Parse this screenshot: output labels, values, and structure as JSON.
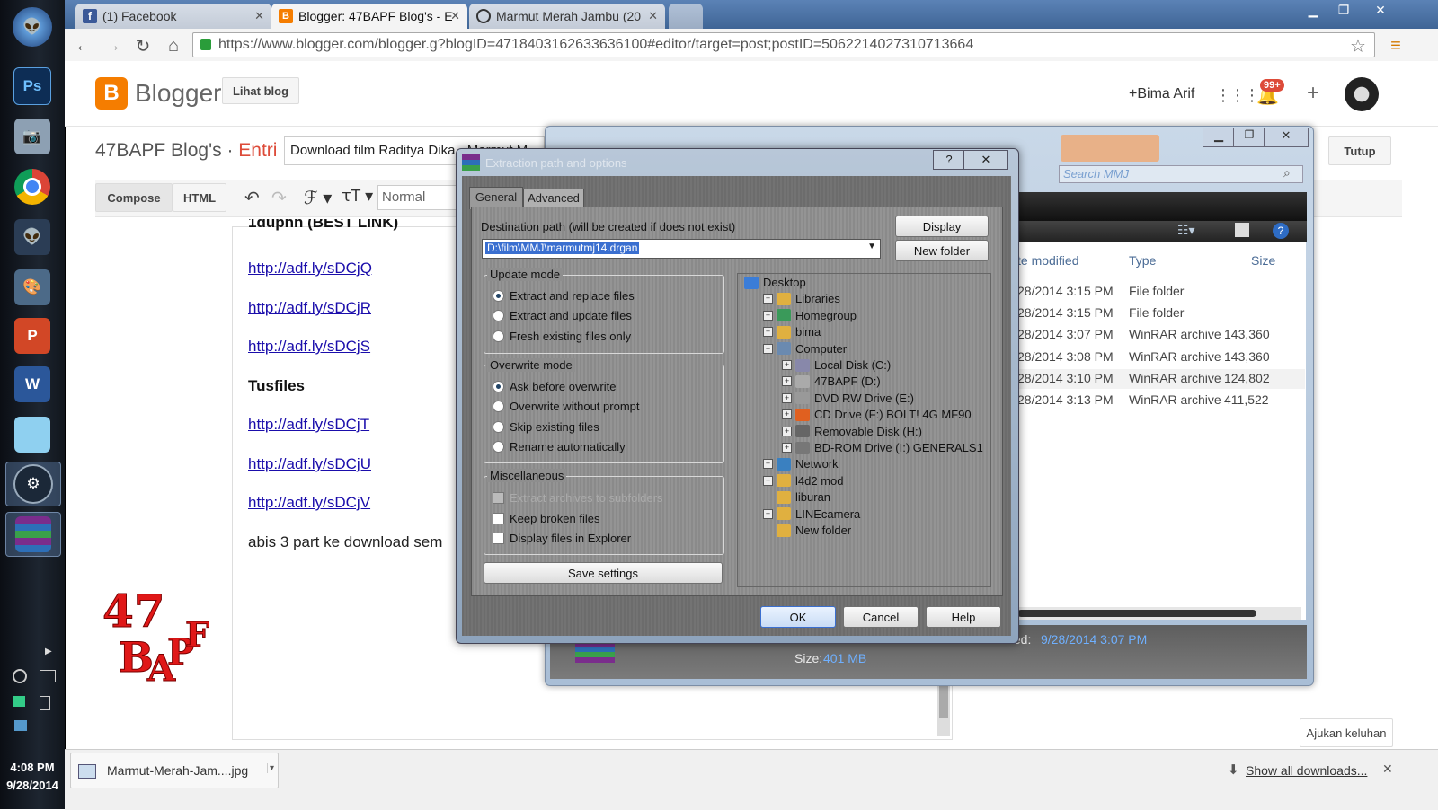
{
  "tabs": [
    {
      "label": "(1) Facebook"
    },
    {
      "label": "Blogger: 47BAPF Blog's - E"
    },
    {
      "label": "Marmut Merah Jambu (20"
    }
  ],
  "url": "https://www.blogger.com/blogger.g?blogID=4718403162633636100#editor/target=post;postID=5062214027310713664",
  "blogger": {
    "logo": "Blogger",
    "view_blog": "Lihat blog",
    "user": "+Bima Arif",
    "notif": "99+",
    "blog_name": "47BAPF Blog's",
    "separator": "·",
    "entry": "Entri",
    "post_title": "Download film Raditya Dika - Marmut M",
    "close": "Tutup",
    "compose": "Compose",
    "html": "HTML",
    "format": "Normal",
    "feedback": "Ajukan keluhan"
  },
  "editor": {
    "partial_heading": "1dupnn (BEST LINK)",
    "links1": [
      "http://adf.ly/sDCjQ",
      "http://adf.ly/sDCjR",
      "http://adf.ly/sDCjS"
    ],
    "tusfiles": "Tusfiles",
    "links2": [
      "http://adf.ly/sDCjT",
      "http://adf.ly/sDCjU",
      "http://adf.ly/sDCjV"
    ],
    "tail": "abis 3 part ke download sem"
  },
  "explorer": {
    "search": "Search MMJ",
    "cols": [
      "te modified",
      "Type",
      "Size"
    ],
    "rows": [
      {
        "date": "28/2014 3:15 PM",
        "type": "File folder",
        "size": ""
      },
      {
        "date": "28/2014 3:15 PM",
        "type": "File folder",
        "size": ""
      },
      {
        "date": "28/2014 3:07 PM",
        "type": "WinRAR archive",
        "size": "143,360"
      },
      {
        "date": "28/2014 3:08 PM",
        "type": "WinRAR archive",
        "size": "143,360"
      },
      {
        "date": "28/2014 3:10 PM",
        "type": "WinRAR archive",
        "size": "124,802"
      },
      {
        "date": "28/2014 3:13 PM",
        "type": "WinRAR archive",
        "size": "411,522"
      }
    ],
    "modified_label": "ted:",
    "modified_value": "9/28/2014 3:07 PM",
    "size_label": "Size:",
    "size_value": "401 MB"
  },
  "dialog": {
    "title": "Extraction path and options",
    "tabs": [
      "General",
      "Advanced"
    ],
    "dest_label": "Destination path (will be created if does not exist)",
    "dest_value": "D:\\film\\MMJ\\marmutmj14.drgan",
    "display": "Display",
    "new_folder": "New folder",
    "update_mode": "Update mode",
    "update_opts": [
      "Extract and replace files",
      "Extract and update files",
      "Fresh existing files only"
    ],
    "overwrite_mode": "Overwrite mode",
    "overwrite_opts": [
      "Ask before overwrite",
      "Overwrite without prompt",
      "Skip existing files",
      "Rename automatically"
    ],
    "misc": "Miscellaneous",
    "misc_opts": [
      "Extract archives to subfolders",
      "Keep broken files",
      "Display files in Explorer"
    ],
    "save": "Save settings",
    "ok": "OK",
    "cancel": "Cancel",
    "help": "Help",
    "tree": [
      "Desktop",
      "Libraries",
      "Homegroup",
      "bima",
      "Computer",
      "Local Disk (C:)",
      "47BAPF (D:)",
      "DVD RW Drive (E:)",
      "CD Drive (F:) BOLT! 4G MF90",
      "Removable Disk (H:)",
      "BD-ROM Drive (I:) GENERALS1",
      "Network",
      "l4d2 mod",
      "liburan",
      "LINEcamera",
      "New folder"
    ]
  },
  "downloads": {
    "file": "Marmut-Merah-Jam....jpg",
    "show_all": "Show all downloads..."
  },
  "clock": {
    "time": "4:08 PM",
    "date": "9/28/2014"
  },
  "watermark": "47BAPF",
  "colors": {
    "blogger_orange": "#f57d00",
    "entri_orange": "#dd4b39",
    "link": "#1a0dab",
    "winrar_sel": "#3a6fd0"
  }
}
